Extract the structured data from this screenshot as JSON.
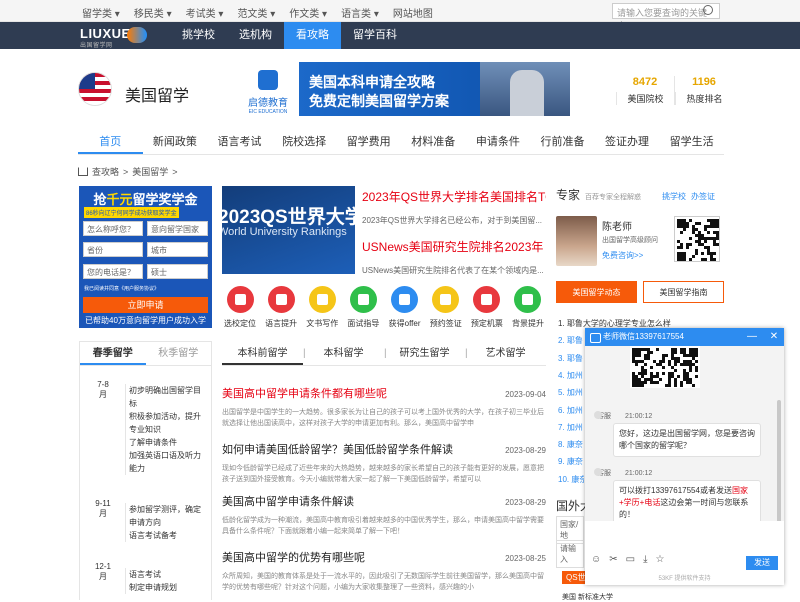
{
  "topbar": {
    "links": [
      "留学类 ▾",
      "移民类 ▾",
      "考试类 ▾",
      "范文类 ▾",
      "作文类 ▾",
      "语言类 ▾",
      "网站地图"
    ],
    "search_placeholder": "请输入您要查询的关键字"
  },
  "brand": {
    "logo": "LIUXUE",
    "logo_sub": "出国留学网"
  },
  "nav": {
    "items": [
      "挑学校",
      "选机构",
      "看攻略",
      "留学百科"
    ],
    "active_index": 2
  },
  "header": {
    "title": "美国留学"
  },
  "banner": {
    "logo_text": "启德教育",
    "logo_sub": "EIC EDUCATION",
    "line1": "美国本科申请全攻略",
    "line2": "免费定制美国留学方案"
  },
  "stats": [
    {
      "value": "8472",
      "label": "美国院校"
    },
    {
      "value": "1196",
      "label": "热度排名"
    }
  ],
  "mainnav": {
    "items": [
      "首页",
      "新闻政策",
      "语言考试",
      "院校选择",
      "留学费用",
      "材料准备",
      "申请条件",
      "行前准备",
      "签证办理",
      "留学生活"
    ],
    "active_index": 0
  },
  "breadcrumb": [
    "查攻略",
    ">",
    "美国留学",
    ">"
  ],
  "leftform": {
    "title_a": "抢",
    "title_b": "千元",
    "title_c": "留学奖学金",
    "sub": "86秒向辽宁何同学成功获取奖学金",
    "fields": [
      {
        "value": "怎么称呼您？",
        "x": 0
      },
      {
        "value": "意向留学国家",
        "x": 1
      },
      {
        "value": "省份",
        "x": 0
      },
      {
        "value": "城市",
        "x": 1
      },
      {
        "value": "您的电话是？",
        "x": 0
      },
      {
        "value": "硕士",
        "x": 1
      }
    ],
    "agree": "我已阅读并同意《用户服务协议》",
    "submit": "立即申请",
    "footer": "已帮助40万意向留学用户成功入学"
  },
  "schedule": {
    "tabs": [
      "春季留学",
      "秋季留学"
    ],
    "periods": [
      {
        "month": "7-8月",
        "items": [
          "初步明确出国留学目标",
          "积极参加活动，提升专业知识",
          "了解申请条件",
          "加强英语口语及听力能力"
        ]
      },
      {
        "month": "9-11月",
        "items": [
          "参加留学测评，确定申请方向",
          "语言考试备考"
        ]
      },
      {
        "month": "12-1月",
        "items": [
          "语言考试",
          "制定申请规划"
        ]
      }
    ]
  },
  "feature": {
    "line1": "2023QS世界大学排名",
    "line2": "World University Rankings"
  },
  "news": [
    {
      "title": "2023年QS世界大学排名美国排名TOP",
      "desc": "2023年QS世界大学排名已经公布，对于到美国留..."
    },
    {
      "title": "USNews美国研究生院排名2023年 US",
      "desc": "USNews美国研究生院排名代表了在某个领域内是..."
    }
  ],
  "quick_icons": [
    {
      "label": "选校定位",
      "color": "#e8383d"
    },
    {
      "label": "语言提升",
      "color": "#e8383d"
    },
    {
      "label": "文书写作",
      "color": "#f5c518"
    },
    {
      "label": "面试指导",
      "color": "#2fbf4a"
    },
    {
      "label": "获得offer",
      "color": "#2d8cf0"
    },
    {
      "label": "预约签证",
      "color": "#f5c518"
    },
    {
      "label": "预定机票",
      "color": "#e8383d"
    },
    {
      "label": "背景提升",
      "color": "#2fbf4a"
    }
  ],
  "subtabs": {
    "items": [
      "本科前留学",
      "本科留学",
      "研究生留学",
      "艺术留学"
    ],
    "active_index": 0
  },
  "articles": [
    {
      "title": "美国高中留学申请条件都有哪些呢",
      "date": "2023-09-04",
      "red": true,
      "summary": "出国留学是中国学生的一大趋势。很多家长为让自己的孩子可以考上国外优秀的大学，在孩子初三毕业后就选择让他出国读高中，这样对孩子大学的申请更加有利。那么，美国高中留学申"
    },
    {
      "title": "如何申请美国低龄留学？美国低龄留学条件解读",
      "date": "2023-08-29",
      "red": false,
      "summary": "现如今低龄留学已经成了近些年来的大热趋势，越来越多的家长希望自己的孩子能有更好的发展，愿意把孩子送到国外接受教育。今天小编就带着大家一起了解一下美国低龄留学，希望可以"
    },
    {
      "title": "美国高中留学申请条件解读",
      "date": "2023-08-29",
      "red": false,
      "summary": "低龄化留学成为一种潮流，美国高中教育吸引着越来越多的中国优秀学生，那么，申请美国高中留学需要具备什么条件呢？下面就跟着小编一起来简单了解一下吧！"
    },
    {
      "title": "美国高中留学的优势有哪些呢",
      "date": "2023-08-25",
      "red": false,
      "summary": "众所周知，美国的教育体系是处于一流水平的，因此吸引了无数国际学生前往美国留学，那么美国高中留学的优势有哪些呢？针对这个问题，小编为大家收集整理了一些资料，感兴趣的小"
    }
  ],
  "expert": {
    "heading": "专家",
    "sub": "百荐专家全程解惑",
    "links": [
      "挑学校",
      "办签证"
    ],
    "name": "陈老师",
    "role": "出国留学高级顾问",
    "consult": "免费咨询>>"
  },
  "right_tabs": {
    "items": [
      "美国留学动态",
      "美国留学指南"
    ],
    "active_index": 0
  },
  "rank_list": [
    "1. 耶鲁大学的心理学专业怎么样",
    "2. 耶鲁",
    "3. 耶鲁",
    "4. 加州",
    "5. 加州",
    "6. 加州",
    "7. 加州",
    "8. 康奈",
    "9. 康奈",
    "10. 康奈"
  ],
  "rank_list_texts": [
    "1. 耶",
    "2. 耶鲁",
    "3. 耶鲁",
    "4. 加州",
    "5. 加州",
    "6. 加州",
    "7. 加州",
    "8. 康奈",
    "9. 康奈",
    "10. 康奈"
  ],
  "right_footer": {
    "heading": "国外大",
    "field1": "国家/地",
    "field2": "请输入",
    "chip": "QS世",
    "item": "美国 新标准大学"
  },
  "chat": {
    "title": "老师微信13397617554",
    "messages": [
      {
        "sender": "客服",
        "time": "21:00:12",
        "text": "您好，这边是出国留学网，您是要咨询哪个国家的留学呢？"
      },
      {
        "sender": "客服",
        "time": "21:00:12",
        "text_a": "可以拨打13397617554或者发送",
        "text_b": "国家+学历+电话",
        "text_c": "这边会第一时间与您联系的！"
      }
    ],
    "send": "发送",
    "powered": "53KF 提供软件支持"
  }
}
